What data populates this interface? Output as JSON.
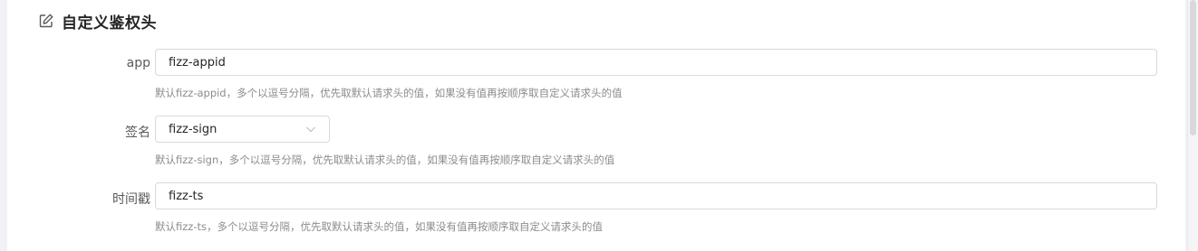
{
  "section": {
    "title": "自定义鉴权头",
    "icon": "edit-icon"
  },
  "fields": [
    {
      "label": "app",
      "value": "fizz-appid",
      "help": "默认fizz-appid，多个以逗号分隔，优先取默认请求头的值，如果没有值再按顺序取自定义请求头的值"
    },
    {
      "label": "签名",
      "value": "fizz-sign",
      "help": "默认fizz-sign，多个以逗号分隔，优先取默认请求头的值，如果没有值再按顺序取自定义请求头的值",
      "icon": "chevron-down-icon"
    },
    {
      "label": "时间戳",
      "value": "fizz-ts",
      "help": "默认fizz-ts，多个以逗号分隔，优先取默认请求头的值，如果没有值再按顺序取自定义请求头的值"
    }
  ]
}
